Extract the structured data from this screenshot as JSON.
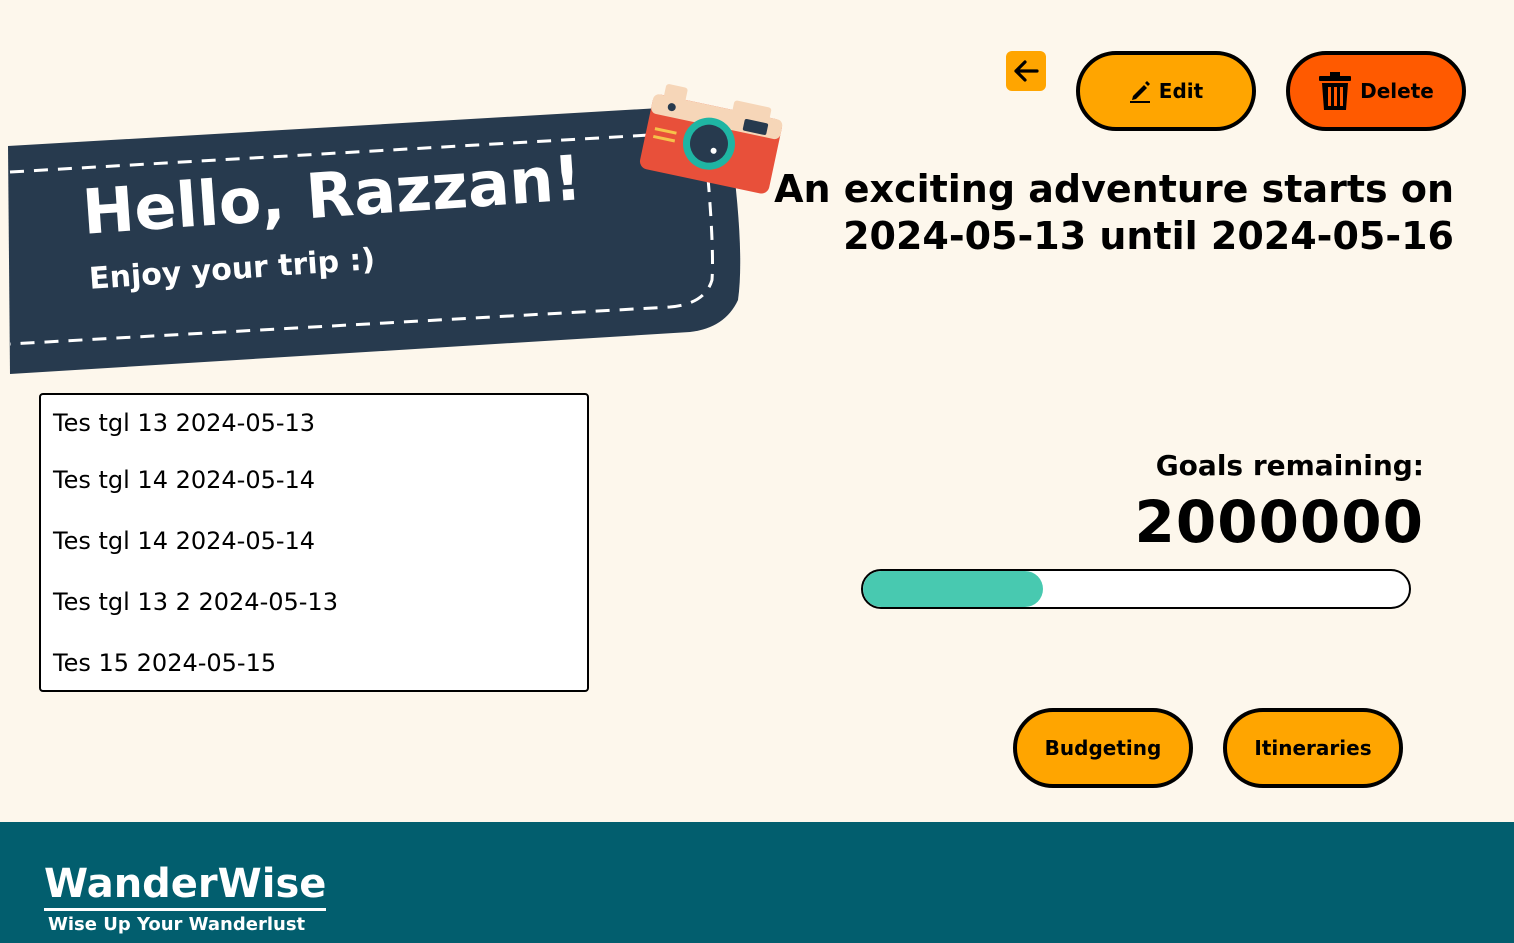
{
  "header": {
    "back_icon": "arrow-left-icon",
    "edit_label": "Edit",
    "edit_icon": "pencil-icon",
    "delete_label": "Delete",
    "delete_icon": "trash-icon"
  },
  "banner": {
    "greeting": "Hello, Razzan!",
    "subtitle": "Enjoy your trip :)",
    "decoration_icon": "camera-icon"
  },
  "trip": {
    "headline_line1": "An exciting adventure starts on",
    "headline_line2": "2024-05-13 until 2024-05-16"
  },
  "goals": {
    "label": "Goals remaining:",
    "value": "2000000",
    "progress_fraction": 0.33,
    "progress_color": "#48c9b0"
  },
  "itinerary_list": {
    "items": [
      {
        "label": "Tes tgl 13 2024-05-13"
      },
      {
        "label": "Tes tgl 14 2024-05-14"
      },
      {
        "label": "Tes tgl 14 2024-05-14"
      },
      {
        "label": "Tes tgl 13 2 2024-05-13"
      },
      {
        "label": "Tes 15 2024-05-15"
      }
    ]
  },
  "actions": {
    "budgeting_label": "Budgeting",
    "itineraries_label": "Itineraries"
  },
  "footer": {
    "brand": "WanderWise",
    "tagline": "Wise Up Your Wanderlust"
  },
  "colors": {
    "background": "#fdf7ec",
    "accent_orange": "#ffa500",
    "delete_orange": "#ff5a00",
    "banner_navy": "#273a4e",
    "footer_teal": "#025e6e"
  }
}
